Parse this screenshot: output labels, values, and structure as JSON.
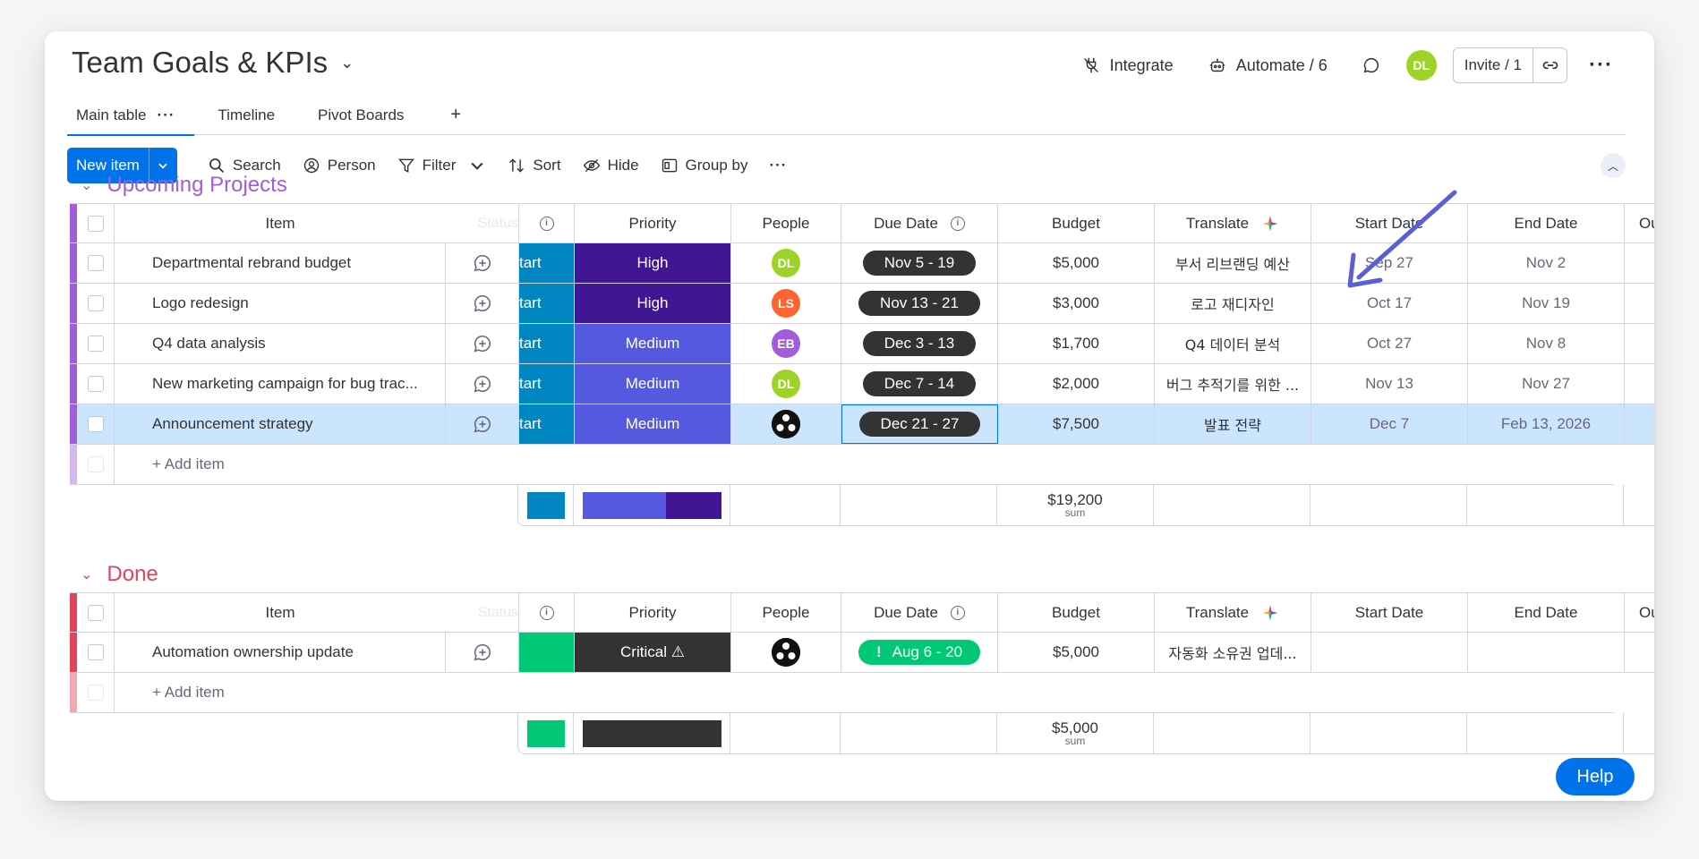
{
  "header": {
    "title": "Team Goals & KPIs",
    "integrate": "Integrate",
    "automate": "Automate / 6",
    "user_initials": "DL",
    "invite": "Invite / 1"
  },
  "tabs": [
    {
      "label": "Main table"
    },
    {
      "label": "Timeline"
    },
    {
      "label": "Pivot Boards"
    }
  ],
  "toolbar": {
    "new_item": "New item",
    "search": "Search",
    "person": "Person",
    "filter": "Filter",
    "sort": "Sort",
    "hide": "Hide",
    "group_by": "Group by"
  },
  "columns": {
    "item": "Item",
    "status_ghost": "Status",
    "priority": "Priority",
    "people": "People",
    "due_date": "Due Date",
    "budget": "Budget",
    "translate": "Translate",
    "start_date": "Start Date",
    "end_date": "End Date",
    "owner_cut": "Ou"
  },
  "groups": [
    {
      "title": "Upcoming Projects",
      "color": "#a25ddc",
      "rows": [
        {
          "item": "Departmental rebrand budget",
          "status": "tart",
          "priority": "High",
          "priority_color": "#401694",
          "person": "DL",
          "person_color": "#9cd326",
          "due": "Nov 5 - 19",
          "budget": "$5,000",
          "translate": "부서 리브랜딩 예산",
          "start": "Sep 27",
          "end": "Nov 2"
        },
        {
          "item": "Logo redesign",
          "status": "tart",
          "priority": "High",
          "priority_color": "#401694",
          "person": "LS",
          "person_color": "#ff642e",
          "due": "Nov 13 - 21",
          "budget": "$3,000",
          "translate": "로고 재디자인",
          "start": "Oct 17",
          "end": "Nov 19"
        },
        {
          "item": "Q4 data analysis",
          "status": "tart",
          "priority": "Medium",
          "priority_color": "#5559df",
          "person": "EB",
          "person_color": "#a25ddc",
          "due": "Dec 3 - 13",
          "budget": "$1,700",
          "translate": "Q4 데이터 분석",
          "start": "Oct 27",
          "end": "Nov 8"
        },
        {
          "item": "New marketing campaign for bug trac...",
          "status": "tart",
          "priority": "Medium",
          "priority_color": "#5559df",
          "person": "DL",
          "person_color": "#9cd326",
          "due": "Dec 7 - 14",
          "budget": "$2,000",
          "translate": "버그 추적기를 위한 ...",
          "start": "Nov 13",
          "end": "Nov 27"
        },
        {
          "item": "Announcement strategy",
          "status": "tart",
          "priority": "Medium",
          "priority_color": "#5559df",
          "person": "",
          "person_color": "#111111",
          "due": "Dec 21 - 27",
          "budget": "$7,500",
          "translate": "발표 전략",
          "start": "Dec 7",
          "end": "Feb 13, 2026"
        }
      ],
      "add_item": "+ Add item",
      "sum": "$19,200",
      "sum_label": "sum"
    },
    {
      "title": "Done",
      "color": "#e2445c",
      "rows": [
        {
          "item": "Automation ownership update",
          "status": "",
          "priority": "Critical ⚠",
          "priority_color": "#333333",
          "person": "",
          "person_color": "#111111",
          "due": "Aug 6 - 20",
          "due_mark": "!",
          "budget": "$5,000",
          "translate": "자동화 소유권 업데...",
          "start": "",
          "end": ""
        }
      ],
      "add_item": "+ Add item",
      "sum": "$5,000",
      "sum_label": "sum"
    }
  ],
  "help": "Help",
  "colors": {
    "primary": "#0073ea",
    "status_working": "#0086c0",
    "status_done": "#00c875",
    "arrow": "#5b5fd6"
  }
}
